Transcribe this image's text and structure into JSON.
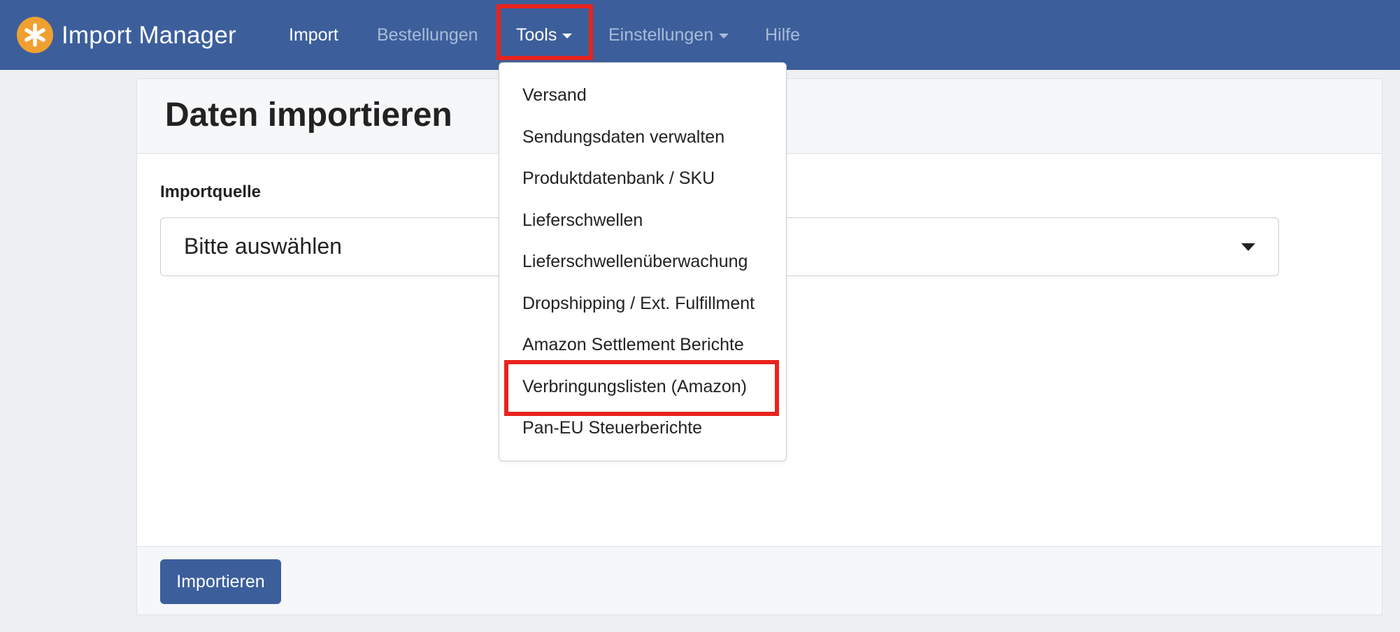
{
  "brand": {
    "name": "Import Manager",
    "logo_icon": "asterisk-logo-icon",
    "logo_color": "#f0a030"
  },
  "nav": {
    "import": "Import",
    "orders": "Bestellungen",
    "tools": "Tools",
    "settings": "Einstellungen",
    "help": "Hilfe"
  },
  "tools_menu": {
    "items": [
      "Versand",
      "Sendungsdaten verwalten",
      "Produktdatenbank / SKU",
      "Lieferschwellen",
      "Lieferschwellenüberwachung",
      "Dropshipping / Ext. Fulfillment",
      "Amazon Settlement Berichte",
      "Verbringungslisten (Amazon)",
      "Pan-EU Steuerberichte"
    ]
  },
  "page": {
    "title": "Daten importieren",
    "source_label": "Importquelle",
    "source_selected": "Bitte auswählen",
    "submit_label": "Importieren"
  },
  "colors": {
    "navbar": "#3c5f9b",
    "primary_button": "#3c5f9b",
    "highlight": "#e8231c",
    "page_background": "#eef0f4"
  }
}
